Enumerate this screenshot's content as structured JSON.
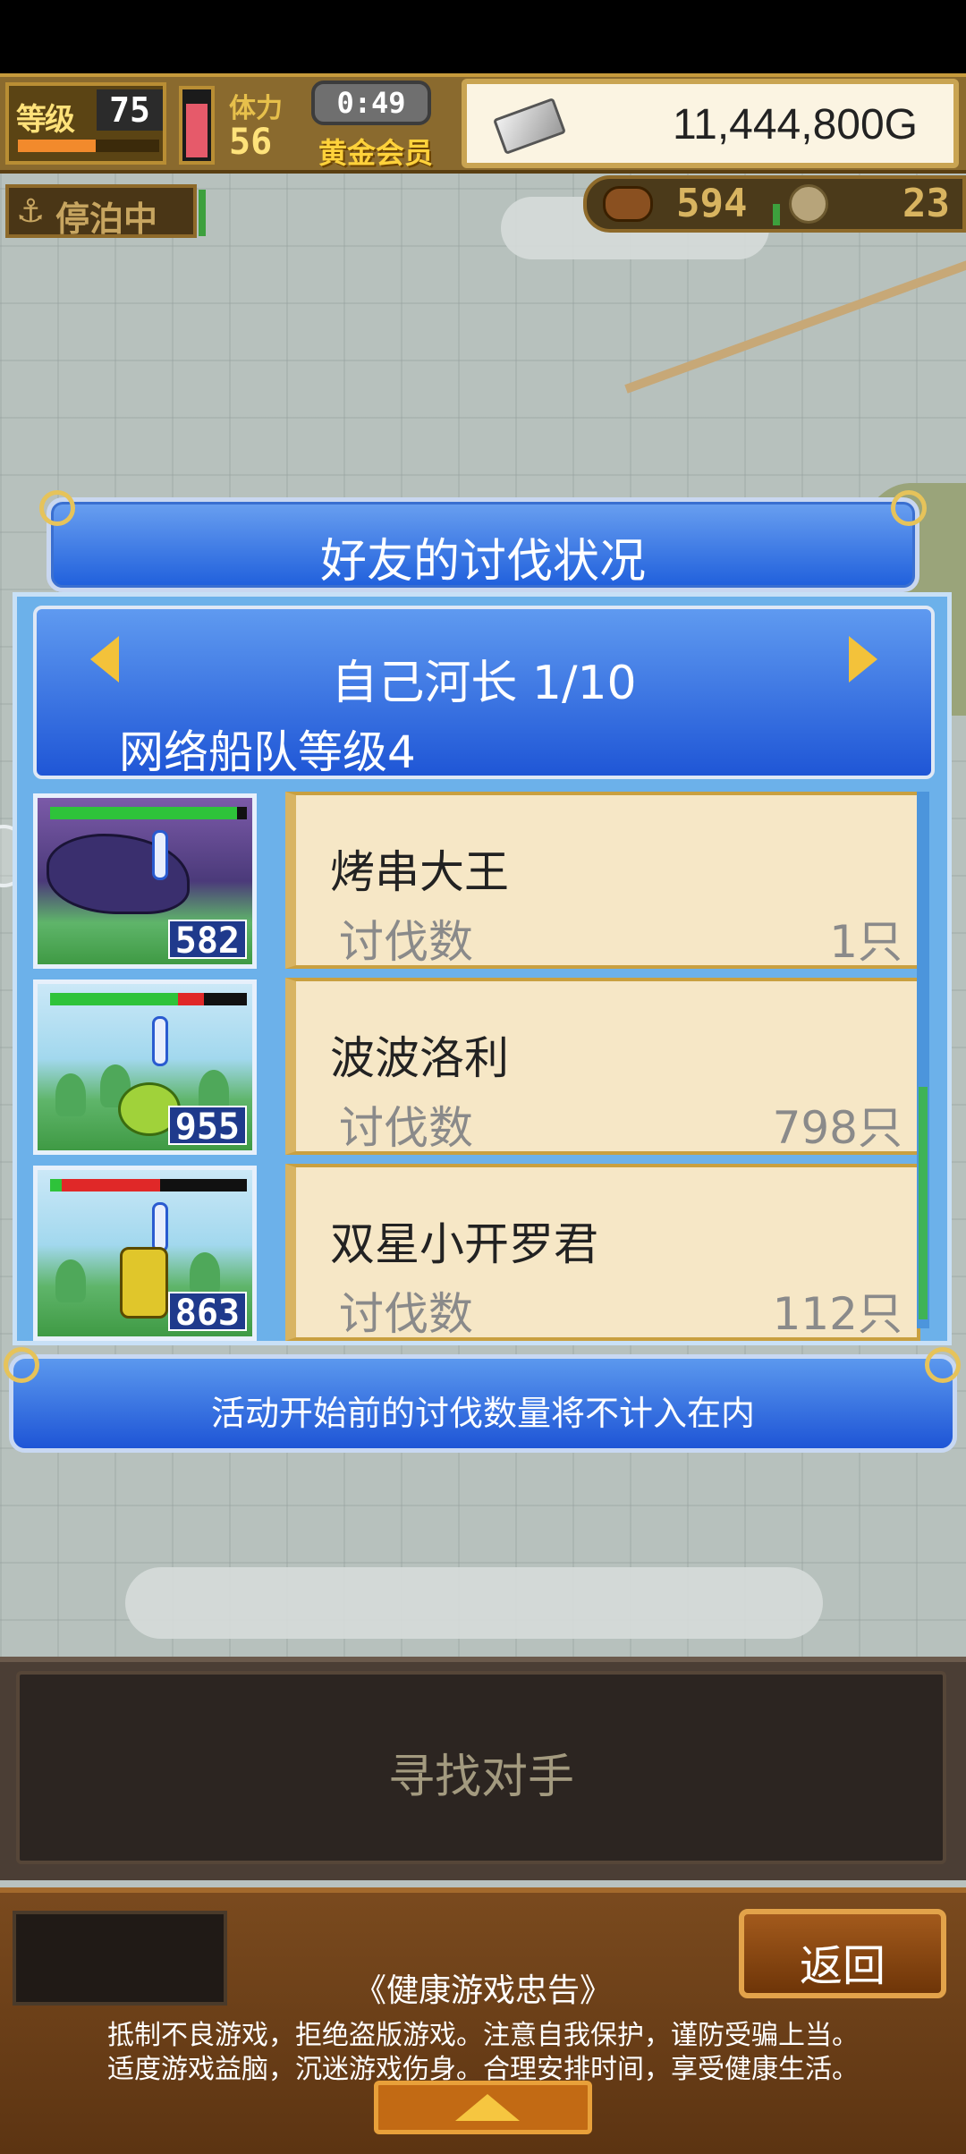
{
  "hud": {
    "level_label": "等级",
    "level_value": "75",
    "level_progress": 0.55,
    "stamina_label": "体力",
    "stamina_value": "56",
    "stamina_fill": 0.85,
    "timer": "0:49",
    "membership": "黄金会员",
    "money": "11,444,800G",
    "anchor_status": "停泊中",
    "resource_1": "594",
    "resource_2": "23"
  },
  "dialog": {
    "title": "好友的讨伐状况",
    "page_label": "自己河长 1/10",
    "fleet_level": "网络船队等级4",
    "kill_label": "讨伐数",
    "notice": "活动开始前的讨伐数量将不计入在内",
    "friends": [
      {
        "name": "烤串大王",
        "level": "582",
        "kills": "1只",
        "hp": 0.95,
        "hp_red": 0
      },
      {
        "name": "波波洛利",
        "level": "955",
        "kills": "798只",
        "hp": 0.65,
        "hp_red": 0.13
      },
      {
        "name": "双星小开罗君",
        "level": "863",
        "kills": "112只",
        "hp": 0.06,
        "hp_red": 0.5
      }
    ]
  },
  "bottom": {
    "find_opponent": "寻找对手",
    "back": "返回",
    "advice_title": "《健康游戏忠告》",
    "advice_line1": "抵制不良游戏，拒绝盗版游戏。注意自我保护，谨防受骗上当。",
    "advice_line2": "适度游戏益脑，沉迷游戏伤身。合理安排时间，享受健康生活。"
  },
  "icons": {
    "money": "silver-bar-icon",
    "anchor": "anchor-icon",
    "chest": "treasure-chest-icon",
    "coin": "coin-icon",
    "prev": "arrow-left-icon",
    "next": "arrow-right-icon",
    "expand": "triangle-up-icon"
  },
  "colors": {
    "dialog_blue": "#1f5fdc",
    "card_bg": "#f6e7c6",
    "gold": "#f3c23a",
    "hp_green": "#2ec33a",
    "hp_red": "#e02828"
  }
}
